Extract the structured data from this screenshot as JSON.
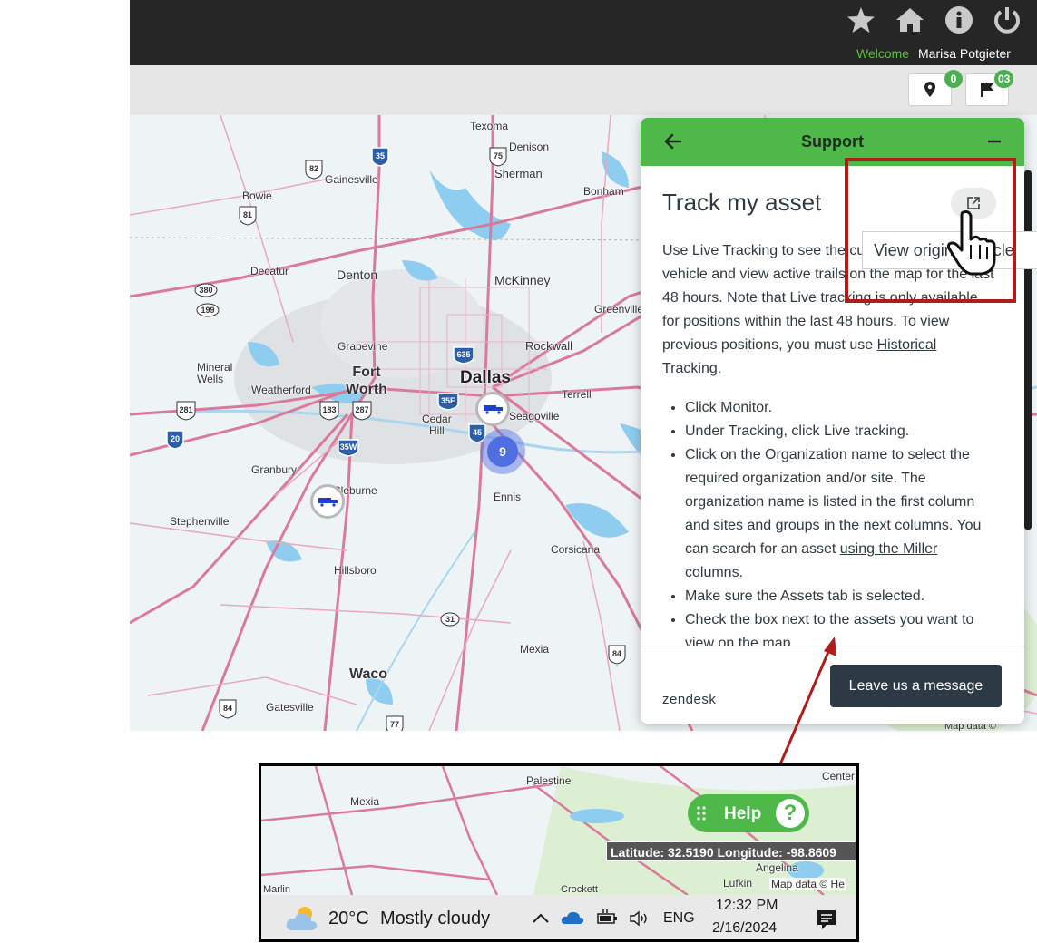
{
  "header": {
    "welcome_label": "Welcome",
    "user_name": "Marisa Potgieter",
    "icons": [
      "star-icon",
      "home-icon",
      "info-icon",
      "power-icon"
    ]
  },
  "toolbar": {
    "location_badge": "0",
    "flag_badge": "03"
  },
  "map": {
    "cluster_count": "9",
    "labels": {
      "texoma": "Texoma",
      "denison": "Denison",
      "sherman": "Sherman",
      "bonham": "Bonham",
      "gainesville": "Gainesville",
      "bowie": "Bowie",
      "decatur": "Decatur",
      "denton": "Denton",
      "mckinney": "McKinney",
      "greenville": "Greenville",
      "grapevine": "Grapevine",
      "rockwall": "Rockwall",
      "mineral_wells": "Mineral\nWells",
      "fort_worth": "Fort\nWorth",
      "dallas": "Dallas",
      "weatherford": "Weatherford",
      "terrell": "Terrell",
      "cedar_hill": "Cedar\nHill",
      "seagoville": "Seagoville",
      "granbury": "Granbury",
      "cleburne": "Cleburne",
      "ennis": "Ennis",
      "stephenville": "Stephenville",
      "corsicana": "Corsicana",
      "hillsboro": "Hillsboro",
      "mexia": "Mexia",
      "waco": "Waco",
      "gatesville": "Gatesville"
    },
    "highways": [
      "35",
      "75",
      "82",
      "81",
      "380",
      "199",
      "635",
      "20",
      "281",
      "183",
      "287",
      "35E",
      "45",
      "35W",
      "31",
      "84",
      "77"
    ],
    "attribution": "Map data ©"
  },
  "support": {
    "header_title": "Support",
    "article_title": "Track my asset",
    "intro": "Use Live Tracking to see the current position of your vehicle and view active trails on the map for the last 48 hours. Note that Live tracking is only available for positions within the last 48 hours. To view previous positions, you must use ",
    "intro_link": "Historical Tracking.",
    "steps": {
      "s1": "Click Monitor.",
      "s2": "Under Tracking, click Live tracking.",
      "s3a": "Click on the Organization name to select the required organization and/or site. The organization name is listed in the first column and sites and groups in the next columns. You can search for an asset ",
      "s3_link": "using the Miller columns",
      "s3b": ".",
      "s4": "Make sure the Assets tab is selected.",
      "s5": "Check the box next to the assets you want to view on the map."
    },
    "tooltip": "View original article",
    "brand": "zendesk",
    "leave_message": "Leave us a message"
  },
  "inset": {
    "labels": {
      "palestine": "Palestine",
      "mexia": "Mexia",
      "center": "Center",
      "angelina": "Angelina",
      "lufkin": "Lufkin",
      "marlin": "Marlin",
      "crockett": "Crockett"
    },
    "help_label": "Help",
    "coordinates": "Latitude: 32.5190 Longitude: -98.8609",
    "attribution": "Map data © He",
    "weather_temp": "20°C",
    "weather_condition": "Mostly cloudy",
    "language": "ENG",
    "time": "12:32 PM",
    "date": "2/16/2024"
  },
  "colors": {
    "header_bg": "#262626",
    "accent_green": "#4eb848",
    "button_dark": "#2d3944",
    "highlight_red": "#b01c1c",
    "cluster_blue": "#4f6fe0"
  }
}
